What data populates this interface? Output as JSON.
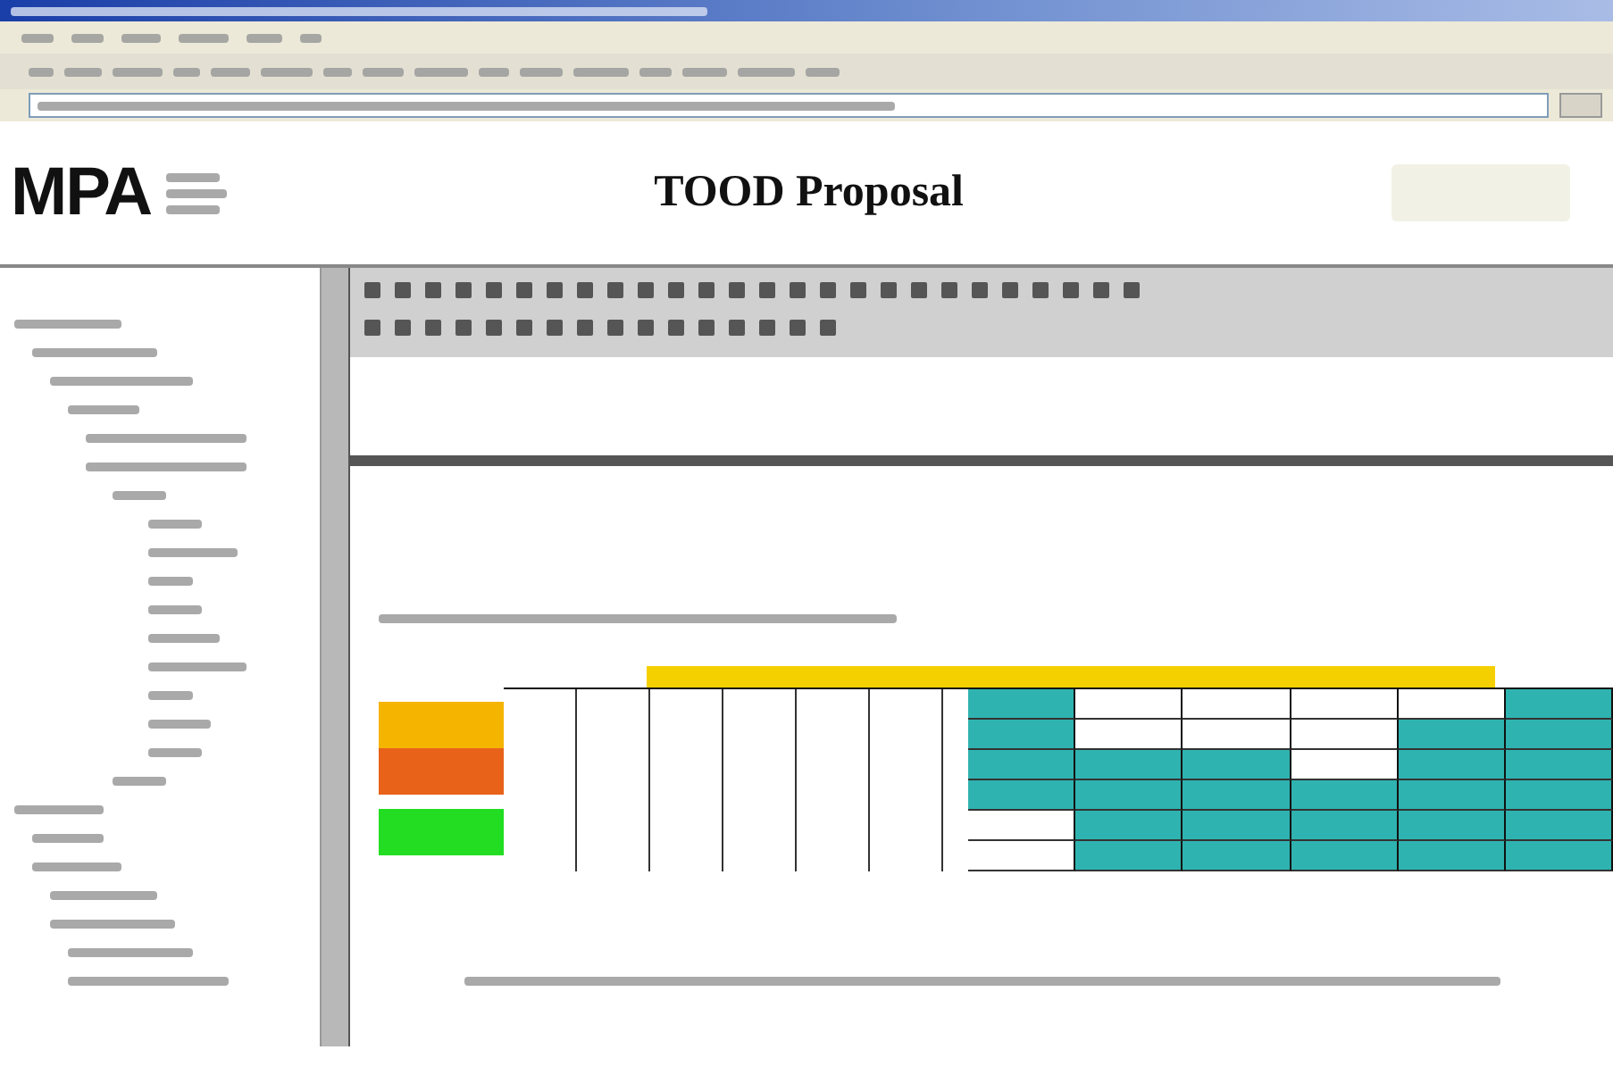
{
  "header": {
    "logo": "MPA",
    "title": "TOOD Proposal"
  },
  "legend": [
    {
      "color": "#f5b400"
    },
    {
      "color": "#e8621a"
    },
    {
      "color": "#22dd22"
    }
  ],
  "schedule": {
    "columns": [
      {
        "cells": [
          {
            "filled": true
          },
          {
            "filled": true
          },
          {
            "filled": true
          },
          {
            "filled": true
          },
          {
            "filled": false
          },
          {
            "filled": false
          }
        ]
      },
      {
        "cells": [
          {
            "filled": false
          },
          {
            "filled": false
          },
          {
            "filled": true
          },
          {
            "filled": true
          },
          {
            "filled": true
          },
          {
            "filled": true
          }
        ]
      },
      {
        "cells": [
          {
            "filled": false
          },
          {
            "filled": false
          },
          {
            "filled": true
          },
          {
            "filled": true
          },
          {
            "filled": true
          },
          {
            "filled": true
          }
        ]
      },
      {
        "cells": [
          {
            "filled": false
          },
          {
            "filled": false
          },
          {
            "filled": false
          },
          {
            "filled": true
          },
          {
            "filled": true
          },
          {
            "filled": true
          }
        ]
      },
      {
        "cells": [
          {
            "filled": false
          },
          {
            "filled": true
          },
          {
            "filled": true
          },
          {
            "filled": true
          },
          {
            "filled": true
          },
          {
            "filled": true
          }
        ]
      },
      {
        "cells": [
          {
            "filled": true
          },
          {
            "filled": true
          },
          {
            "filled": true
          },
          {
            "filled": true
          },
          {
            "filled": true
          },
          {
            "filled": true
          }
        ]
      }
    ]
  }
}
